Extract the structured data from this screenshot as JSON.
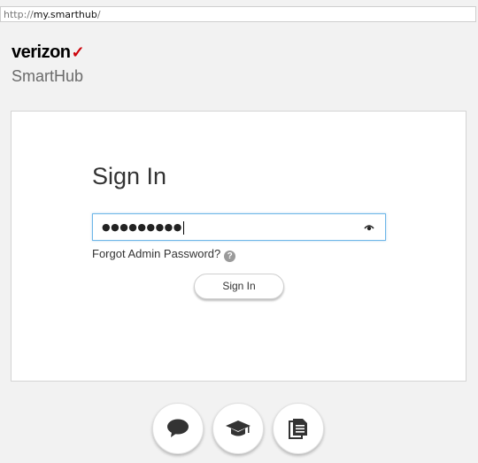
{
  "browser": {
    "address_prefix": "http://",
    "address_host": "my.smarthub",
    "address_suffix": "/"
  },
  "brand": {
    "logo_text": "verizon",
    "logo_mark": "✓",
    "product_name": "SmartHub",
    "accent_color": "#cd040b"
  },
  "signin": {
    "title": "Sign In",
    "password_value": "●●●●●●●●●",
    "password_toggle_icon": "eye-icon",
    "forgot_label": "Forgot Admin Password?",
    "help_glyph": "?",
    "button_label": "Sign In"
  },
  "footer_icons": [
    "chat-bubble-icon",
    "graduation-cap-icon",
    "document-icon"
  ]
}
